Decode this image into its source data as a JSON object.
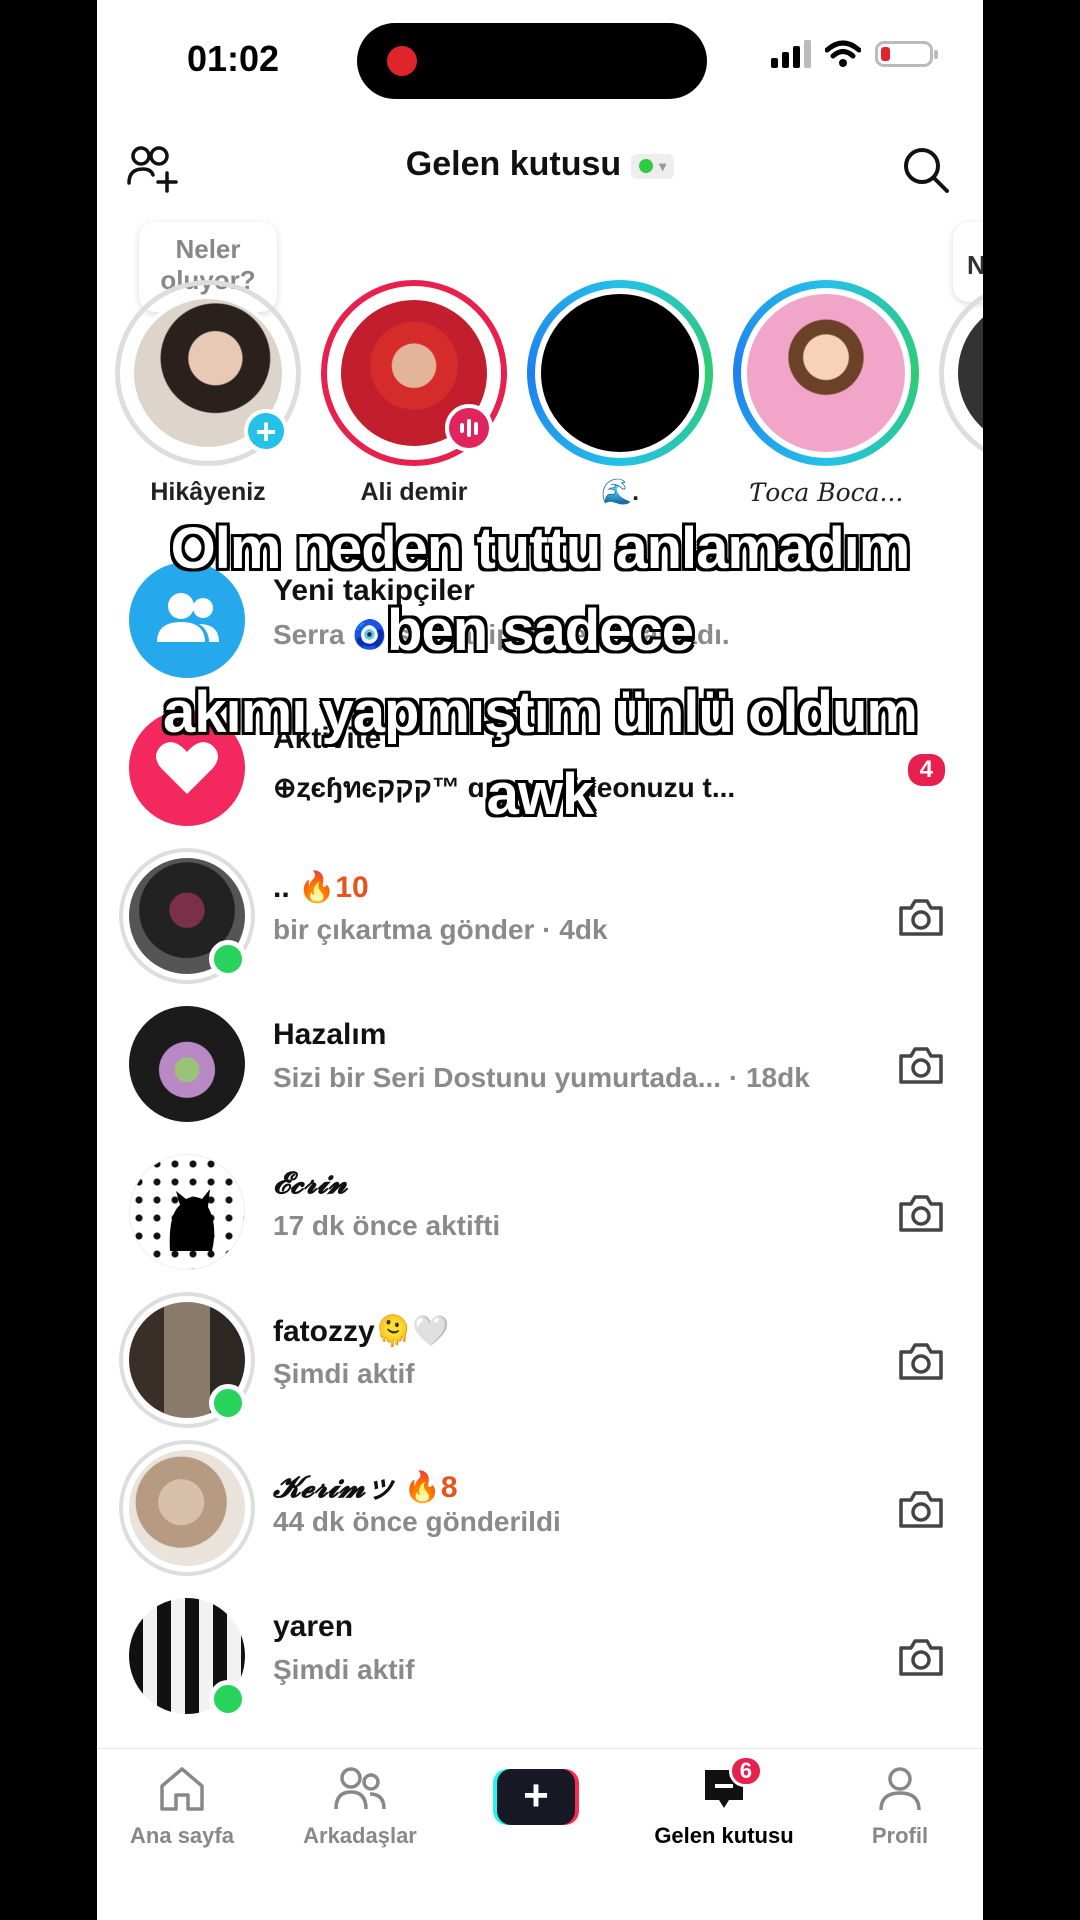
{
  "status_bar": {
    "time": "01:02"
  },
  "header": {
    "title": "Gelen kutusu"
  },
  "stories": {
    "bubble": "Neler oluyor?",
    "bubble_partial": "N",
    "items": [
      {
        "name": "Hikâyeniz"
      },
      {
        "name": "Ali demir"
      },
      {
        "name": "🌊."
      },
      {
        "name": "Ƭoca Boca..."
      }
    ]
  },
  "rows": [
    {
      "title": "Yeni takipçiler",
      "subtitle": "Serra 🧿 sizi takip etmeye başladı."
    },
    {
      "title": "Aktivite",
      "subtitle": "⊕ȥєɧทєקקק™ ɑnna♪ videonuzu t...",
      "badge": "4"
    },
    {
      "title": "..",
      "streak": "🔥10",
      "subtitle": "bir çıkartma gönder · 4dk"
    },
    {
      "title": "Hazalım",
      "subtitle": "Sizi bir Seri Dostunu yumurtada...  · 18dk"
    },
    {
      "title": "𝓔𝓬𝓻𝓲𝓷",
      "subtitle": "17 dk önce aktifti"
    },
    {
      "title": "fatozzy🫠🤍",
      "subtitle": "Şimdi aktif"
    },
    {
      "title": "𝓚𝓮𝓻𝓲𝓶ッ",
      "streak": "🔥8",
      "subtitle": "44 dk önce gönderildi"
    },
    {
      "title": "yaren",
      "subtitle": "Şimdi aktif"
    }
  ],
  "caption": {
    "line1": "Olm  neden tuttu anlamadım",
    "line2": "ben sadece",
    "line3": "akımı yapmıştım ünlü oldum",
    "line4": "awk"
  },
  "nav": {
    "home": "Ana sayfa",
    "friends": "Arkadaşlar",
    "inbox": "Gelen kutusu",
    "inbox_badge": "6",
    "profile": "Profil"
  },
  "icons": [
    "add-friends-icon",
    "search-icon",
    "camera-icon",
    "home-icon",
    "friends-icon",
    "inbox-icon",
    "profile-icon",
    "plus-icon"
  ],
  "colors": {
    "accent_red": "#e8204e",
    "online_green": "#27d35a",
    "cyan": "#25c1e8"
  }
}
